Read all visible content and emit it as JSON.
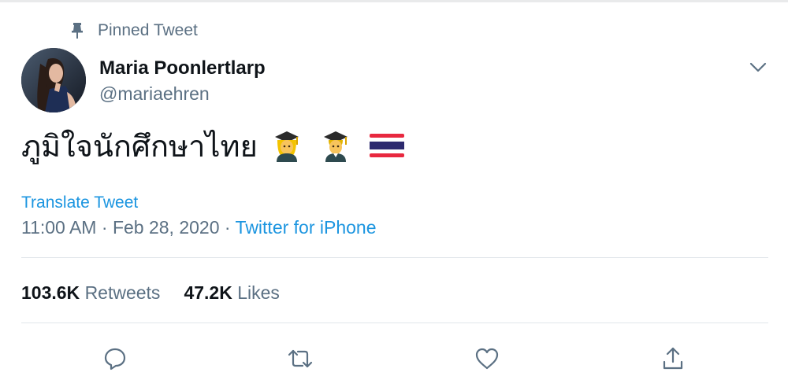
{
  "pinned_label": "Pinned Tweet",
  "author": {
    "name": "Maria Poonlertlarp",
    "handle": "@mariaehren"
  },
  "tweet": {
    "text": "ภูมิใจนักศึกษาไทย",
    "emojis": [
      "woman-student-icon",
      "man-student-icon",
      "thailand-flag-icon"
    ]
  },
  "translate_label": "Translate Tweet",
  "meta": {
    "time": "11:00 AM",
    "date": "Feb 28, 2020",
    "separator": "·",
    "source": "Twitter for iPhone"
  },
  "stats": {
    "retweets_count": "103.6K",
    "retweets_label": "Retweets",
    "likes_count": "47.2K",
    "likes_label": "Likes"
  },
  "actions": [
    "reply-icon",
    "retweet-icon",
    "like-icon",
    "share-icon"
  ],
  "colors": {
    "link": "#1b95e0",
    "secondary_text": "#5b7083",
    "primary_text": "#0f1419",
    "divider": "#e1e6ea"
  }
}
